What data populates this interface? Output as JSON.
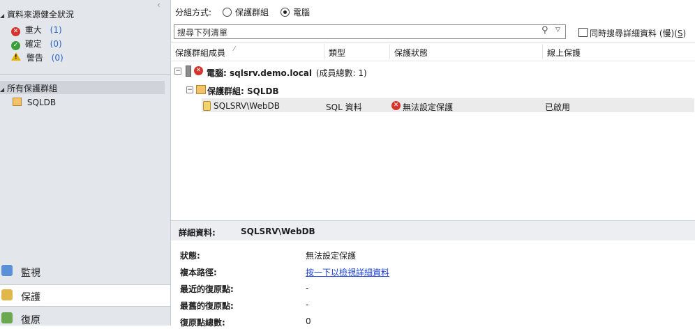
{
  "left_pane": {
    "health": {
      "title": "資料來源健全狀況",
      "items": [
        {
          "label": "重大",
          "count": "(1)",
          "icon": "error-icon",
          "color": "#d4342c"
        },
        {
          "label": "確定",
          "count": "(0)",
          "icon": "ok-icon",
          "color": "#3a9f3a"
        },
        {
          "label": "警告",
          "count": "(0)",
          "icon": "warning-icon",
          "color": "#e6b400"
        }
      ]
    },
    "groups": {
      "title": "所有保護群組",
      "items": [
        {
          "label": "SQLDB",
          "icon": "protection-group-icon"
        }
      ]
    },
    "nav": [
      {
        "label": "監視",
        "icon": "monitor-icon"
      },
      {
        "label": "保護",
        "icon": "protection-icon",
        "active": true
      },
      {
        "label": "復原",
        "icon": "recovery-icon"
      }
    ]
  },
  "toolbar": {
    "group_by_label": "分組方式:",
    "option_protection_group": "保護群組",
    "option_computer": "電腦",
    "selected_option": "電腦"
  },
  "search": {
    "placeholder": "搜尋下列清單",
    "value": "",
    "also_search_label": "同時搜尋詳細資料 (慢)(",
    "also_search_key": "S",
    "also_search_suffix": ")"
  },
  "table": {
    "columns": [
      "保護群組成員",
      "類型",
      "保護狀態",
      "線上保護"
    ],
    "computer_row": {
      "prefix": "電腦: ",
      "name": "sqlsrv.demo.local",
      "count_text": "(成員總數: 1)",
      "expand": "−"
    },
    "group_row": {
      "prefix": "保護群組: ",
      "name": "SQLDB",
      "expand": "−"
    },
    "rows": [
      {
        "member": "SQLSRV\\WebDB",
        "type": "SQL 資料",
        "status": "無法設定保護",
        "online": "已啟用",
        "status_icon": "error-icon"
      }
    ]
  },
  "details": {
    "header_label": "詳細資料:",
    "header_value": "SQLSRV\\WebDB",
    "fields": [
      {
        "label": "狀態:",
        "value": "無法設定保護"
      },
      {
        "label": "複本路徑:",
        "value": "按一下以檢視詳細資料",
        "link": true
      },
      {
        "label": "最近的復原點:",
        "value": "-"
      },
      {
        "label": "最舊的復原點:",
        "value": "-"
      },
      {
        "label": "復原點總數:",
        "value": "0"
      }
    ]
  }
}
